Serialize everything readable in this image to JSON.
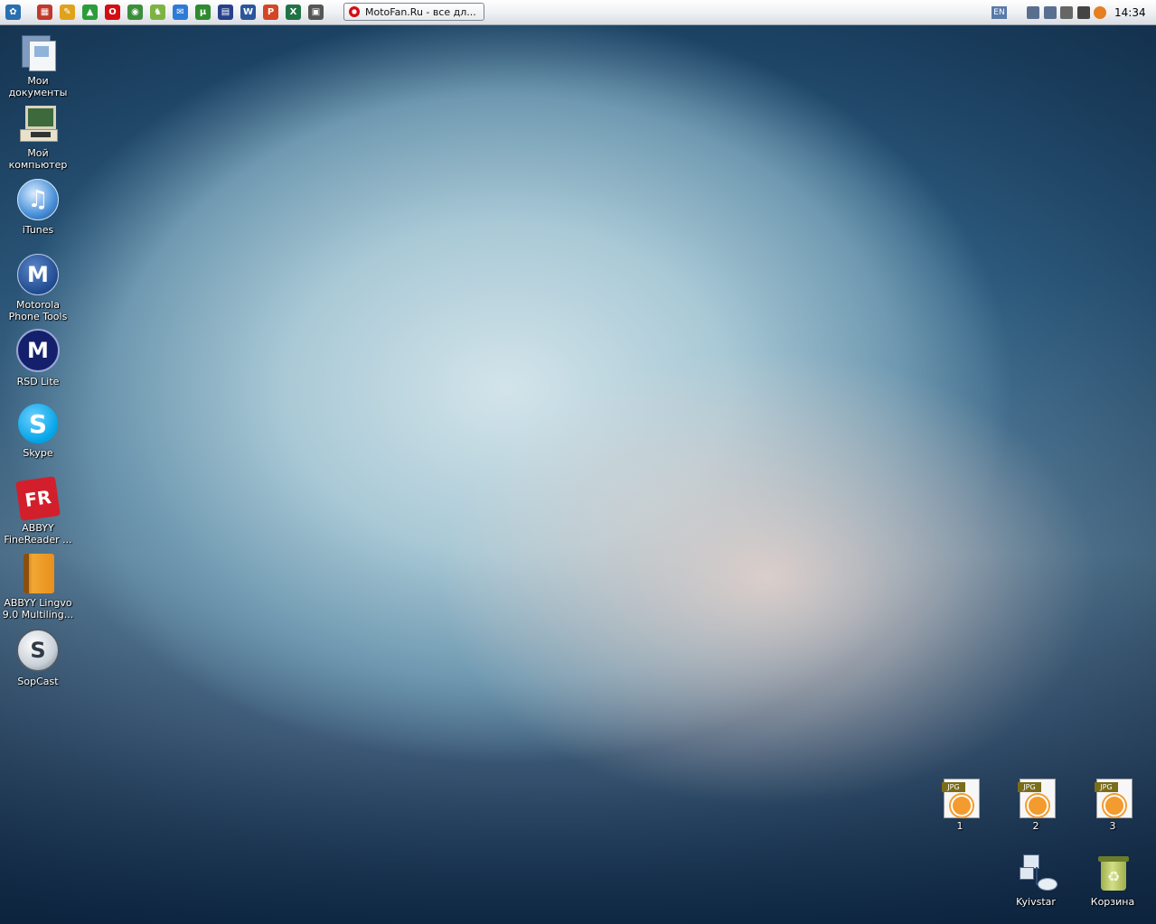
{
  "taskbar": {
    "quicklaunch": [
      {
        "name": "start-icon",
        "color": "#2a6fb0",
        "glyph": "✿"
      },
      {
        "name": "calendar-icon",
        "color": "#c0392b",
        "glyph": "▦"
      },
      {
        "name": "pencil-icon",
        "color": "#e0a21a",
        "glyph": "✎"
      },
      {
        "name": "drive-icon",
        "color": "#2c9d3a",
        "glyph": "▲"
      },
      {
        "name": "opera-icon",
        "color": "#d40d12",
        "glyph": "O"
      },
      {
        "name": "chrome-icon",
        "color": "#3b8e3a",
        "glyph": "◉"
      },
      {
        "name": "android-icon",
        "color": "#7cb342",
        "glyph": "♞"
      },
      {
        "name": "chat-icon",
        "color": "#2d7bd6",
        "glyph": "✉"
      },
      {
        "name": "utorrent-icon",
        "color": "#2e8b2e",
        "glyph": "µ"
      },
      {
        "name": "save-icon",
        "color": "#27408b",
        "glyph": "▤"
      },
      {
        "name": "word-icon",
        "color": "#2b579a",
        "glyph": "W"
      },
      {
        "name": "powerpoint-icon",
        "color": "#d24726",
        "glyph": "P"
      },
      {
        "name": "excel-icon",
        "color": "#217346",
        "glyph": "X"
      },
      {
        "name": "screenshot-icon",
        "color": "#555555",
        "glyph": "▣"
      }
    ],
    "window_button": "MotoFan.Ru - все дл...",
    "language": "EN",
    "tray": [
      {
        "name": "network-icon",
        "color": "#5a6f8f"
      },
      {
        "name": "network2-icon",
        "color": "#5a6f8f"
      },
      {
        "name": "volume-icon",
        "color": "#666666"
      },
      {
        "name": "sun-icon",
        "color": "#444444"
      },
      {
        "name": "update-icon",
        "color": "#e67e22"
      }
    ],
    "clock": "14:34"
  },
  "desktop": {
    "left_icons": [
      {
        "name": "my-documents",
        "label": "Мои документы",
        "icon": "folder-icon"
      },
      {
        "name": "my-computer",
        "label": "Мой компьютер",
        "icon": "computer-icon"
      },
      {
        "name": "itunes",
        "label": "iTunes",
        "icon": "itunes-icon"
      },
      {
        "name": "motorola-phone-tools",
        "label": "Motorola Phone Tools",
        "icon": "motorola-icon"
      },
      {
        "name": "rsd-lite",
        "label": "RSD Lite",
        "icon": "rsd-icon"
      },
      {
        "name": "skype",
        "label": "Skype",
        "icon": "skype-icon"
      },
      {
        "name": "abbyy-finereader",
        "label": "ABBYY FineReader ...",
        "icon": "finereader-icon"
      },
      {
        "name": "abbyy-lingvo",
        "label": "ABBYY Lingvo 9.0 Multiling...",
        "icon": "lingvo-icon"
      },
      {
        "name": "sopcast",
        "label": "SopCast",
        "icon": "sopcast-icon"
      }
    ],
    "files": [
      {
        "label": "1",
        "badge": "JPG"
      },
      {
        "label": "2",
        "badge": "JPG"
      },
      {
        "label": "3",
        "badge": "JPG"
      }
    ],
    "kyivstar": "Kyivstar",
    "recycle_bin": "Корзина"
  }
}
